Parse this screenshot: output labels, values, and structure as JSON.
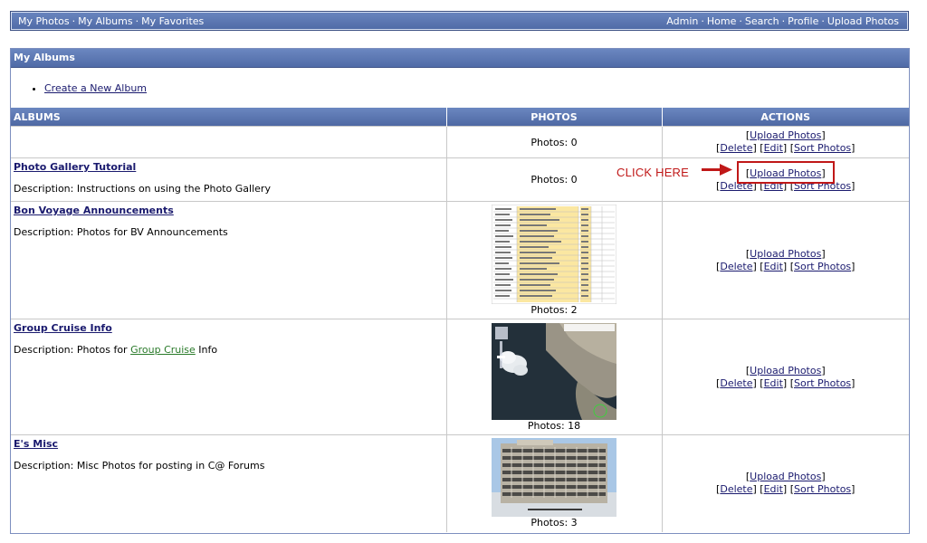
{
  "nav": {
    "left": [
      "My Photos",
      "My Albums",
      "My Favorites"
    ],
    "right": [
      "Admin",
      "Home",
      "Search",
      "Profile",
      "Upload Photos"
    ],
    "separator": "·"
  },
  "panel": {
    "title": "My Albums",
    "create_link": "Create a New Album"
  },
  "table": {
    "headers": {
      "albums": "ALBUMS",
      "photos": "PHOTOS",
      "actions": "ACTIONS"
    }
  },
  "actions": {
    "upload": "Upload Photos",
    "delete": "Delete",
    "edit": "Edit",
    "sort": "Sort Photos"
  },
  "albums": [
    {
      "title": "",
      "description": "",
      "photos": "Photos: 0"
    },
    {
      "title": "Photo Gallery Tutorial",
      "description": "Description: Instructions on using the Photo Gallery",
      "photos": "Photos: 0"
    },
    {
      "title": "Bon Voyage Announcements",
      "description": "Description: Photos for BV Announcements",
      "photos": "Photos: 2"
    },
    {
      "title": "Group Cruise Info",
      "description_prefix": "Description: Photos for ",
      "description_link": "Group Cruise",
      "description_suffix": " Info",
      "photos": "Photos: 18"
    },
    {
      "title": "E's Misc",
      "description": "Description: Misc Photos for posting in C@ Forums",
      "photos": "Photos: 3"
    }
  ],
  "annotation": {
    "text": "CLICK HERE",
    "color": "#c01818"
  }
}
